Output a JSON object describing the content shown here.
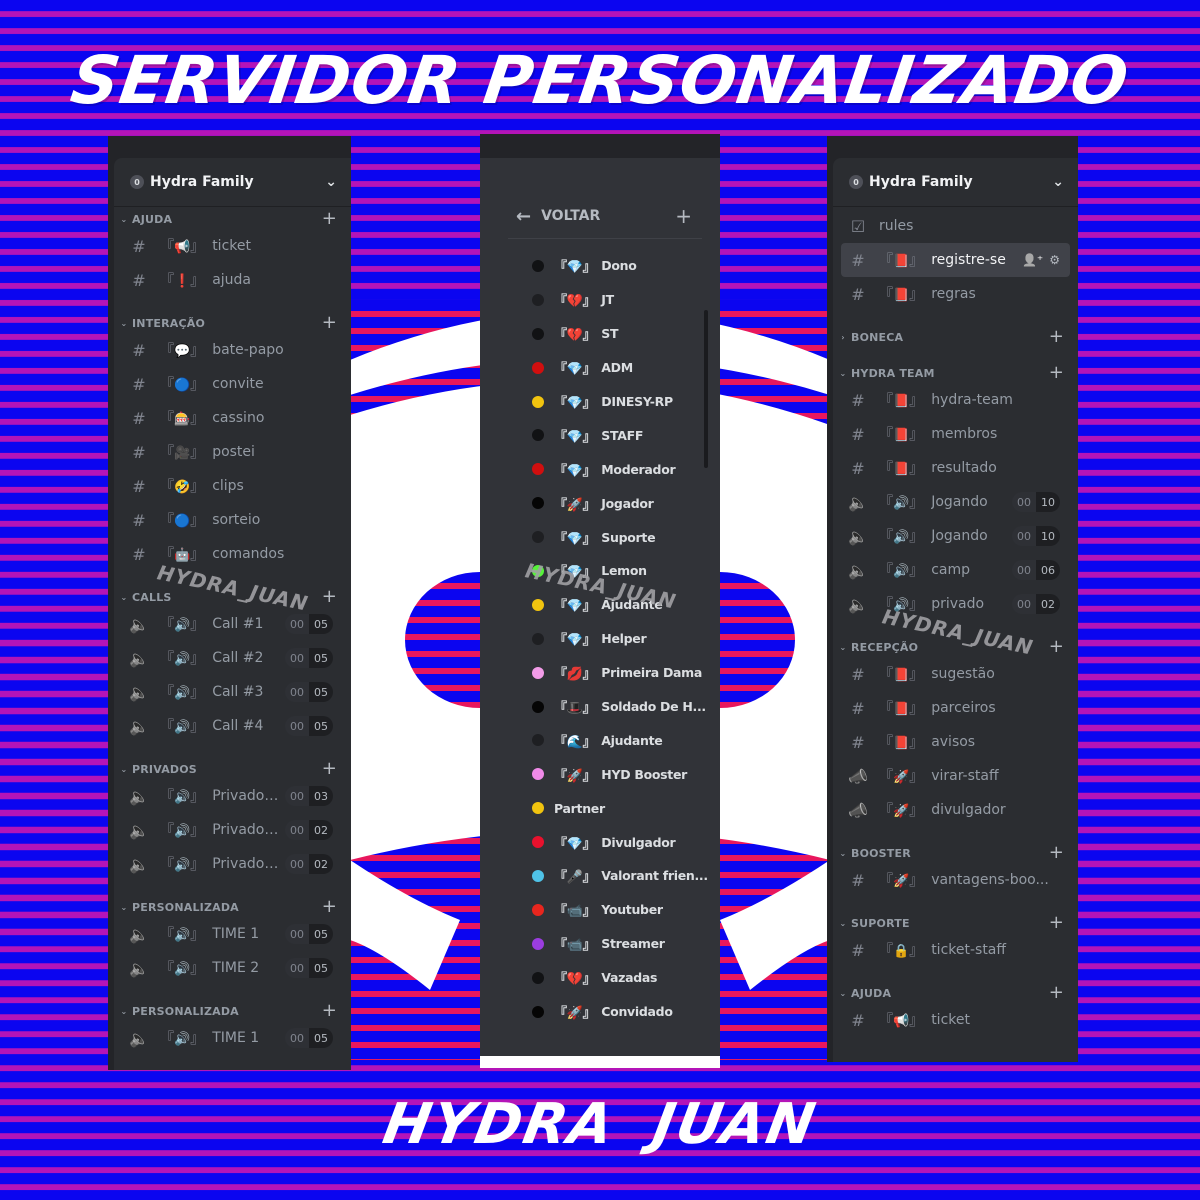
{
  "banner": {
    "title": "SERVIDOR PERSONALIZADO",
    "footer": "HYDRA JUAN",
    "watermark": "HYDRA_JUAN",
    "colors": {
      "stripe_blue": "#0b05f0",
      "stripe_magenta": "#b414b8",
      "logo_stripe_red": "#e8175d",
      "panel_bg": "#2b2d31"
    }
  },
  "left_panel": {
    "server_name": "Hydra Family",
    "categories": [
      {
        "name": "AJUDA",
        "channels": [
          {
            "type": "text",
            "emoji": "📢",
            "label": "ticket"
          },
          {
            "type": "text",
            "emoji": "❗",
            "label": "ajuda"
          }
        ]
      },
      {
        "name": "INTERAÇÃO",
        "channels": [
          {
            "type": "text-locked",
            "emoji": "💬",
            "label": "bate-papo"
          },
          {
            "type": "text",
            "emoji": "🔵",
            "label": "convite"
          },
          {
            "type": "text",
            "emoji": "🎰",
            "label": "cassino"
          },
          {
            "type": "text",
            "emoji": "🎥",
            "label": "postei"
          },
          {
            "type": "text",
            "emoji": "🤣",
            "label": "clips"
          },
          {
            "type": "text",
            "emoji": "🔵",
            "label": "sorteio"
          },
          {
            "type": "text",
            "emoji": "🤖",
            "label": "comandos"
          }
        ]
      },
      {
        "name": "CALLS",
        "channels": [
          {
            "type": "voice-locked",
            "emoji": "🔊",
            "label": "Call #1",
            "users": "00",
            "limit": "05"
          },
          {
            "type": "voice-locked",
            "emoji": "🔊",
            "label": "Call #2",
            "users": "00",
            "limit": "05"
          },
          {
            "type": "voice-locked",
            "emoji": "🔊",
            "label": "Call #3",
            "users": "00",
            "limit": "05"
          },
          {
            "type": "voice-locked",
            "emoji": "🔊",
            "label": "Call #4",
            "users": "00",
            "limit": "05"
          }
        ]
      },
      {
        "name": "PRIVADOS",
        "channels": [
          {
            "type": "voice-locked",
            "emoji": "🔊",
            "label": "Privado ...",
            "users": "00",
            "limit": "03"
          },
          {
            "type": "voice-locked",
            "emoji": "🔊",
            "label": "Privado ...",
            "users": "00",
            "limit": "02"
          },
          {
            "type": "voice-locked",
            "emoji": "🔊",
            "label": "Privado ...",
            "users": "00",
            "limit": "02"
          }
        ]
      },
      {
        "name": "PERSONALIZADA",
        "channels": [
          {
            "type": "voice",
            "emoji": "🔊",
            "label": "TIME 1",
            "users": "00",
            "limit": "05"
          },
          {
            "type": "voice",
            "emoji": "🔊",
            "label": "TIME 2",
            "users": "00",
            "limit": "05"
          }
        ]
      },
      {
        "name": "PERSONALIZADA",
        "channels": [
          {
            "type": "voice",
            "emoji": "🔊",
            "label": "TIME 1",
            "users": "00",
            "limit": "05"
          }
        ]
      }
    ]
  },
  "middle_panel": {
    "back_label": "VOLTAR",
    "roles": [
      {
        "color": "#111214",
        "emoji": "💎",
        "label": "Dono"
      },
      {
        "color": "#1e1f22",
        "emoji": "💔",
        "label": "JT"
      },
      {
        "color": "#111214",
        "emoji": "💔",
        "label": "ST"
      },
      {
        "color": "#d10f0f",
        "emoji": "💎",
        "label": "ADM"
      },
      {
        "color": "#f1c40f",
        "emoji": "💎",
        "label": "DINESY-RP"
      },
      {
        "color": "#111214",
        "emoji": "💎",
        "label": "STAFF"
      },
      {
        "color": "#d10f0f",
        "emoji": "💎",
        "label": "Moderador"
      },
      {
        "color": "#050505",
        "emoji": "🚀",
        "label": "Jogador"
      },
      {
        "color": "#1e1f22",
        "emoji": "💎",
        "label": "Suporte"
      },
      {
        "color": "#57f23a",
        "emoji": "💎",
        "label": "Lemon"
      },
      {
        "color": "#f1c40f",
        "emoji": "💎",
        "label": "Ajudante"
      },
      {
        "color": "#1e1f22",
        "emoji": "💎",
        "label": "Helper"
      },
      {
        "color": "#f29ce8",
        "emoji": "💋",
        "label": "Primeira Dama"
      },
      {
        "color": "#050505",
        "emoji": "🎩",
        "label": "Soldado De H..."
      },
      {
        "color": "#1e1f22",
        "emoji": "🌊",
        "label": "Ajudante"
      },
      {
        "color": "#f08ae8",
        "emoji": "🚀",
        "label": "HYD Booster"
      },
      {
        "color": "#f1c40f",
        "emoji": "",
        "label": "Partner"
      },
      {
        "color": "#e8112d",
        "emoji": "💎",
        "label": "Divulgador"
      },
      {
        "color": "#4fc3e8",
        "emoji": "🎤",
        "label": "Valorant frien..."
      },
      {
        "color": "#e8261e",
        "emoji": "📹",
        "label": "Youtuber"
      },
      {
        "color": "#9b3de0",
        "emoji": "📹",
        "label": "Streamer"
      },
      {
        "color": "#111214",
        "emoji": "💔",
        "label": "Vazadas"
      },
      {
        "color": "#050505",
        "emoji": "🚀",
        "label": "Convidado"
      }
    ]
  },
  "right_panel": {
    "server_name": "Hydra Family",
    "top_channels": [
      {
        "type": "rules",
        "emoji": "",
        "label": "rules"
      },
      {
        "type": "text-locked",
        "emoji": "📕",
        "label": "registre-se",
        "active": true
      },
      {
        "type": "text",
        "emoji": "📕",
        "label": "regras"
      }
    ],
    "categories": [
      {
        "name": "BONECA",
        "collapsed": true,
        "channels": []
      },
      {
        "name": "HYDRA TEAM",
        "channels": [
          {
            "type": "text-locked",
            "emoji": "📕",
            "label": "hydra-team"
          },
          {
            "type": "text-locked",
            "emoji": "📕",
            "label": "membros"
          },
          {
            "type": "text-locked",
            "emoji": "📕",
            "label": "resultado"
          },
          {
            "type": "voice-locked",
            "emoji": "🔊",
            "label": "Jogando",
            "users": "00",
            "limit": "10"
          },
          {
            "type": "voice-locked",
            "emoji": "🔊",
            "label": "Jogando",
            "users": "00",
            "limit": "10"
          },
          {
            "type": "voice-locked",
            "emoji": "🔊",
            "label": "camp",
            "users": "00",
            "limit": "06"
          },
          {
            "type": "voice-locked",
            "emoji": "🔊",
            "label": "privado",
            "users": "00",
            "limit": "02"
          }
        ]
      },
      {
        "name": "RECEPÇÃO",
        "channels": [
          {
            "type": "text",
            "emoji": "📕",
            "label": "sugestão"
          },
          {
            "type": "text-locked",
            "emoji": "📕",
            "label": "parceiros"
          },
          {
            "type": "text",
            "emoji": "📕",
            "label": "avisos"
          },
          {
            "type": "announce",
            "emoji": "🚀",
            "label": "virar-staff"
          },
          {
            "type": "announce",
            "emoji": "🚀",
            "label": "divulgador"
          }
        ]
      },
      {
        "name": "BOOSTER",
        "channels": [
          {
            "type": "text",
            "emoji": "🚀",
            "label": "vantagens-boo..."
          }
        ]
      },
      {
        "name": "SUPORTE",
        "channels": [
          {
            "type": "text-locked",
            "emoji": "🔒",
            "label": "ticket-staff"
          }
        ]
      },
      {
        "name": "AJUDA",
        "channels": [
          {
            "type": "text",
            "emoji": "📢",
            "label": "ticket"
          }
        ]
      }
    ]
  }
}
